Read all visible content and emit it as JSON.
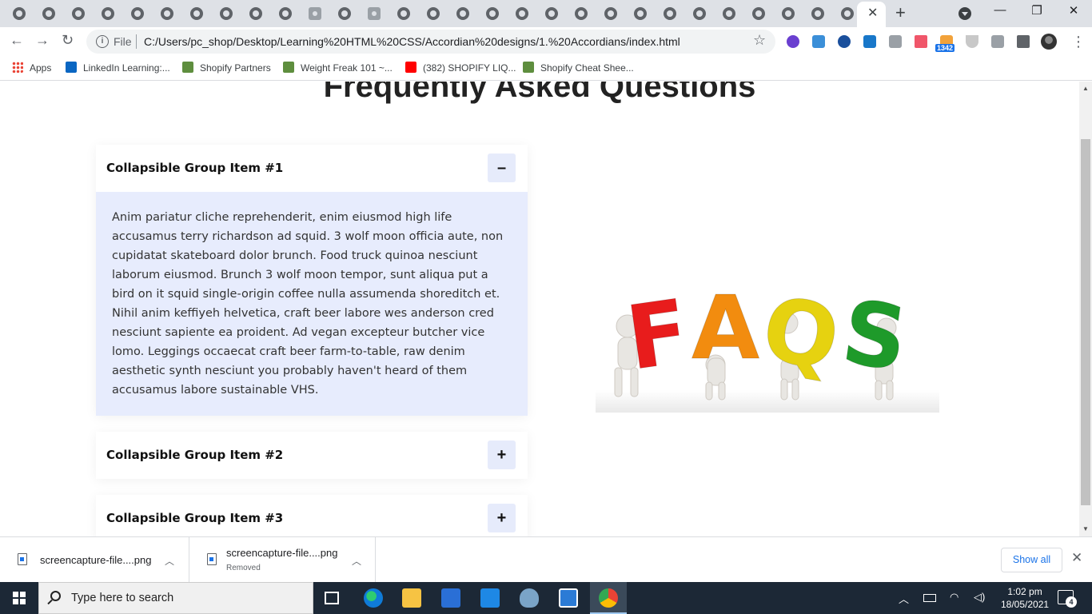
{
  "browser": {
    "address": {
      "scheme_label": "File",
      "url": "C:/Users/pc_shop/Desktop/Learning%20HTML%20CSS/Accordian%20designs/1.%20Accordians/index.html"
    },
    "extension_badge": "1342",
    "bookmarks": [
      {
        "label": "Apps"
      },
      {
        "label": "LinkedIn Learning:..."
      },
      {
        "label": "Shopify Partners"
      },
      {
        "label": "Weight Freak 101 ~..."
      },
      {
        "label": "(382) SHOPIFY LIQ..."
      },
      {
        "label": "Shopify Cheat Shee..."
      }
    ]
  },
  "page": {
    "title": "Frequently Asked Questions",
    "accordion": [
      {
        "title": "Collapsible Group Item #1",
        "toggle": "–",
        "expanded": true,
        "body": "Anim pariatur cliche reprehenderit, enim eiusmod high life accusamus terry richardson ad squid. 3 wolf moon officia aute, non cupidatat skateboard dolor brunch. Food truck quinoa nesciunt laborum eiusmod. Brunch 3 wolf moon tempor, sunt aliqua put a bird on it squid single-origin coffee nulla assumenda shoreditch et. Nihil anim keffiyeh helvetica, craft beer labore wes anderson cred nesciunt sapiente ea proident. Ad vegan excepteur butcher vice lomo. Leggings occaecat craft beer farm-to-table, raw denim aesthetic synth nesciunt you probably haven't heard of them accusamus labore sustainable VHS."
      },
      {
        "title": "Collapsible Group Item #2",
        "toggle": "+",
        "expanded": false
      },
      {
        "title": "Collapsible Group Item #3",
        "toggle": "+",
        "expanded": false
      }
    ],
    "image": {
      "letters": [
        "F",
        "A",
        "Q",
        "S"
      ],
      "colors": [
        "#e81c1c",
        "#f28c0f",
        "#e6d210",
        "#1e9a2a"
      ]
    }
  },
  "downloads": [
    {
      "name": "screencapture-file....png",
      "status": ""
    },
    {
      "name": "screencapture-file....png",
      "status": "Removed"
    }
  ],
  "downloads_show_all": "Show all",
  "taskbar": {
    "search_placeholder": "Type here to search",
    "time": "1:02 pm",
    "date": "18/05/2021",
    "notifications": "4"
  }
}
